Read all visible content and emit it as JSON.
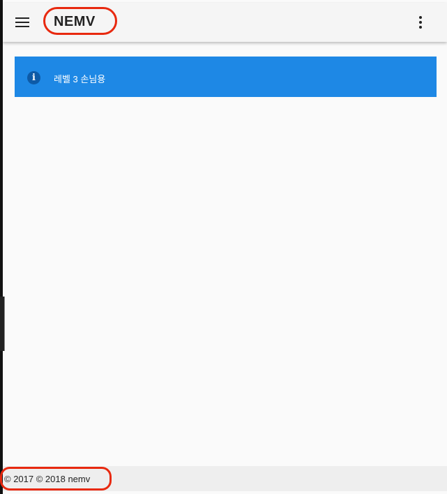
{
  "app_bar": {
    "title": "NEMV",
    "menu_icon": "hamburger-menu-icon",
    "more_icon": "more-vertical-icon"
  },
  "alert": {
    "icon": "info-icon",
    "icon_glyph": "i",
    "text": "레벨 3 손님용",
    "color": "#1e88e5"
  },
  "footer": {
    "text": "© 2017 © 2018 nemv"
  },
  "annotations": {
    "highlight_color": "#e8290f"
  }
}
